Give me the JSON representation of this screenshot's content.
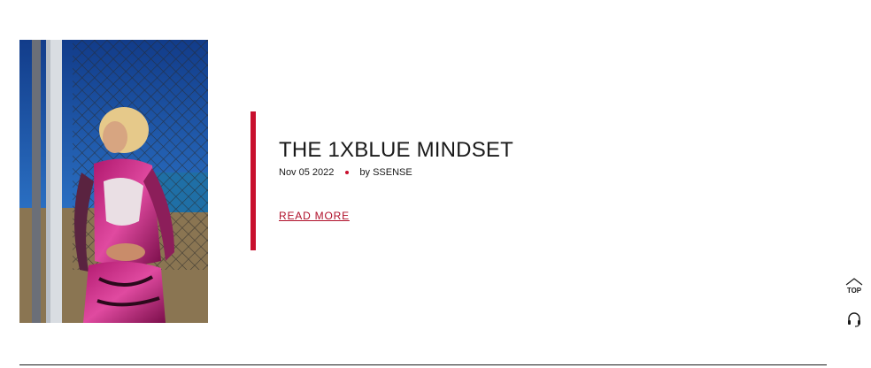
{
  "article": {
    "title": "THE 1XBLUE MINDSET",
    "date": "Nov 05 2022",
    "byline": "by SSENSE",
    "read_more_label": "READ MORE"
  },
  "floating": {
    "top_label": "TOP"
  },
  "colors": {
    "accent": "#c8102e",
    "text": "#1a1a1a",
    "link": "#b0102a"
  },
  "icons": {
    "top": "chevron-up-icon",
    "support": "headset-icon"
  }
}
